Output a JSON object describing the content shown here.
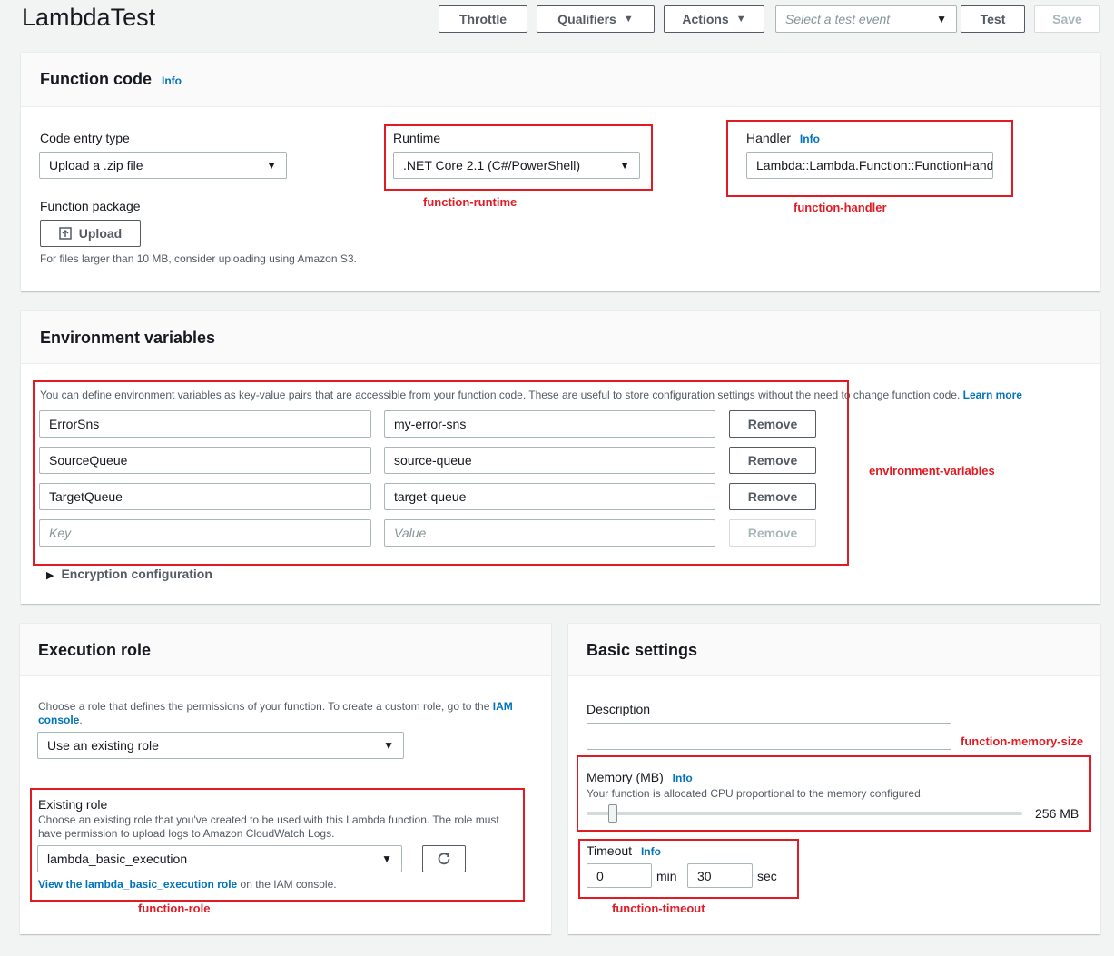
{
  "header": {
    "title": "LambdaTest",
    "buttons": {
      "throttle": "Throttle",
      "qualifiers": "Qualifiers",
      "actions": "Actions",
      "test_event_placeholder": "Select a test event",
      "test": "Test",
      "save": "Save"
    }
  },
  "function_code": {
    "title": "Function code",
    "info": "Info",
    "code_entry_label": "Code entry type",
    "code_entry_value": "Upload a .zip file",
    "runtime_label": "Runtime",
    "runtime_value": ".NET Core 2.1 (C#/PowerShell)",
    "handler_label": "Handler",
    "handler_info": "Info",
    "handler_value": "Lambda::Lambda.Function::FunctionHandler",
    "package_label": "Function package",
    "upload_label": "Upload",
    "upload_help": "For files larger than 10 MB, consider uploading using Amazon S3."
  },
  "environment": {
    "title": "Environment variables",
    "description": "You can define environment variables as key-value pairs that are accessible from your function code. These are useful to store configuration settings without the need to change function code.",
    "learn_more": "Learn more",
    "rows": [
      {
        "key": "ErrorSns",
        "value": "my-error-sns",
        "remove": "Remove"
      },
      {
        "key": "SourceQueue",
        "value": "source-queue",
        "remove": "Remove"
      },
      {
        "key": "TargetQueue",
        "value": "target-queue",
        "remove": "Remove"
      }
    ],
    "key_placeholder": "Key",
    "value_placeholder": "Value",
    "remove_label": "Remove",
    "encryption": "Encryption configuration"
  },
  "execution_role": {
    "title": "Execution role",
    "description_pre": "Choose a role that defines the permissions of your function. To create a custom role, go to the",
    "iam_link_a": "IAM",
    "iam_link_b": "console",
    "role_select": "Use an existing role",
    "existing_label": "Existing role",
    "existing_help": "Choose an existing role that you've created to be used with this Lambda function. The role must have permission to upload logs to Amazon CloudWatch Logs.",
    "existing_value": "lambda_basic_execution",
    "view_link": "View the lambda_basic_execution role",
    "view_suffix": " on the IAM console."
  },
  "basic_settings": {
    "title": "Basic settings",
    "description_label": "Description",
    "memory_label": "Memory (MB)",
    "memory_info": "Info",
    "memory_help": "Your function is allocated CPU proportional to the memory configured.",
    "memory_value": "256 MB",
    "memory_fraction": 0.05,
    "timeout_label": "Timeout",
    "timeout_info": "Info",
    "timeout_min": "0",
    "min_unit": "min",
    "timeout_sec": "30",
    "sec_unit": "sec"
  },
  "annotations": {
    "function_runtime": "function-runtime",
    "function_handler": "function-handler",
    "environment_variables": "environment-variables",
    "function_memory_size": "function-memory-size",
    "function_role": "function-role",
    "function_timeout": "function-timeout"
  },
  "colors": {
    "link": "#0073bb",
    "annotation": "#e01b24",
    "border": "#aab7b8"
  }
}
